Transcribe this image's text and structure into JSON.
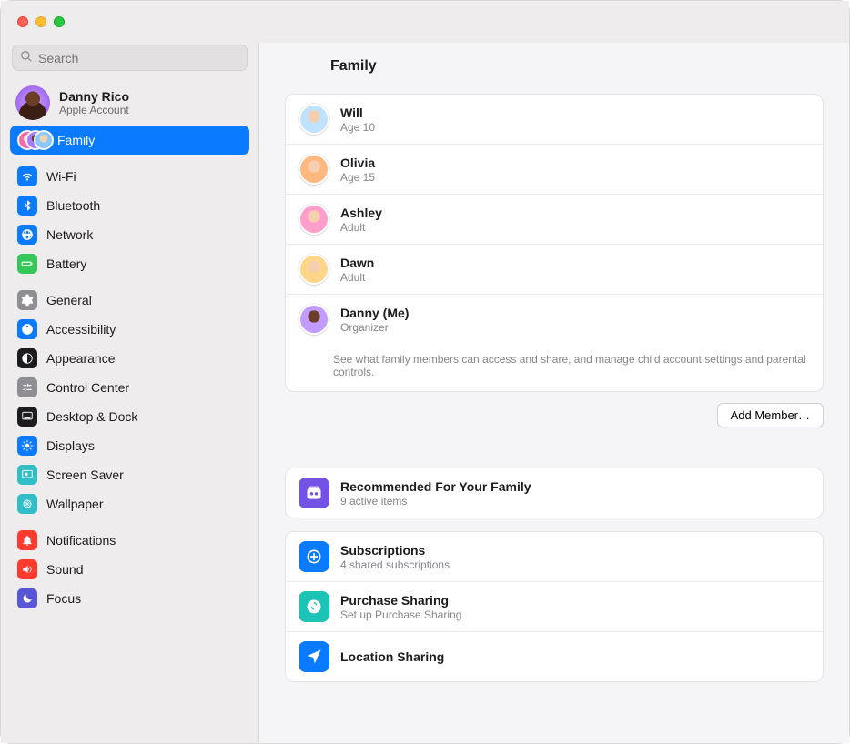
{
  "search": {
    "placeholder": "Search"
  },
  "account": {
    "name": "Danny Rico",
    "sub": "Apple Account"
  },
  "sidebar": {
    "family_label": "Family",
    "groups": [
      [
        {
          "key": "wifi",
          "label": "Wi-Fi",
          "color": "bg-blue",
          "icon": "wifi"
        },
        {
          "key": "bluetooth",
          "label": "Bluetooth",
          "color": "bg-blue",
          "icon": "bluetooth"
        },
        {
          "key": "network",
          "label": "Network",
          "color": "bg-blue",
          "icon": "globe"
        },
        {
          "key": "battery",
          "label": "Battery",
          "color": "bg-green",
          "icon": "battery"
        }
      ],
      [
        {
          "key": "general",
          "label": "General",
          "color": "bg-gray",
          "icon": "gear"
        },
        {
          "key": "accessibility",
          "label": "Accessibility",
          "color": "bg-blue",
          "icon": "accessibility"
        },
        {
          "key": "appearance",
          "label": "Appearance",
          "color": "bg-black",
          "icon": "appearance"
        },
        {
          "key": "control-center",
          "label": "Control Center",
          "color": "bg-gray",
          "icon": "sliders"
        },
        {
          "key": "desktop-dock",
          "label": "Desktop & Dock",
          "color": "bg-black",
          "icon": "dock"
        },
        {
          "key": "displays",
          "label": "Displays",
          "color": "bg-blue",
          "icon": "sun"
        },
        {
          "key": "screen-saver",
          "label": "Screen Saver",
          "color": "bg-teal",
          "icon": "screensaver"
        },
        {
          "key": "wallpaper",
          "label": "Wallpaper",
          "color": "bg-teal",
          "icon": "wallpaper"
        }
      ],
      [
        {
          "key": "notifications",
          "label": "Notifications",
          "color": "bg-red",
          "icon": "bell"
        },
        {
          "key": "sound",
          "label": "Sound",
          "color": "bg-red",
          "icon": "speaker"
        },
        {
          "key": "focus",
          "label": "Focus",
          "color": "bg-indigo",
          "icon": "moon"
        }
      ]
    ]
  },
  "header": {
    "title": "Family"
  },
  "members": [
    {
      "name": "Will",
      "sub": "Age 10",
      "avatar": "avatar-will"
    },
    {
      "name": "Olivia",
      "sub": "Age 15",
      "avatar": "avatar-olivia"
    },
    {
      "name": "Ashley",
      "sub": "Adult",
      "avatar": "avatar-ashley"
    },
    {
      "name": "Dawn",
      "sub": "Adult",
      "avatar": "avatar-dawn"
    },
    {
      "name": "Danny (Me)",
      "sub": "Organizer",
      "avatar": "avatar-danny"
    }
  ],
  "members_footnote": "See what family members can access and share, and manage child account settings and parental controls.",
  "add_member_label": "Add Member…",
  "settings": {
    "recommended": {
      "title": "Recommended For Your Family",
      "sub": "9 active items",
      "color": "bg-purple",
      "icon": "recommended"
    },
    "subscriptions": {
      "title": "Subscriptions",
      "sub": "4 shared subscriptions",
      "color": "bg-blue",
      "icon": "subscription"
    },
    "purchase": {
      "title": "Purchase Sharing",
      "sub": "Set up Purchase Sharing",
      "color": "bg-teal",
      "icon": "purchase"
    },
    "location": {
      "title": "Location Sharing",
      "sub": "",
      "color": "bg-blue",
      "icon": "location"
    }
  }
}
